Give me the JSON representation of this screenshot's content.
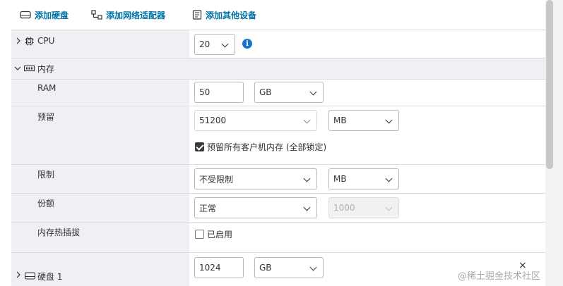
{
  "toolbar": {
    "add_disk": "添加硬盘",
    "add_network": "添加网络适配器",
    "add_other": "添加其他设备"
  },
  "cpu": {
    "label": "CPU",
    "value": "20"
  },
  "memory": {
    "label": "内存",
    "ram": {
      "label": "RAM",
      "value": "50",
      "unit": "GB"
    },
    "reservation": {
      "label": "预留",
      "value": "51200",
      "unit": "MB",
      "checkbox_label": "预留所有客户机内存 (全部锁定)",
      "checkbox_checked": true
    },
    "limit": {
      "label": "限制",
      "value": "不受限制",
      "unit": "MB"
    },
    "shares": {
      "label": "份额",
      "value": "正常",
      "number": "1000"
    },
    "hot_plug": {
      "label": "内存热插拔",
      "checkbox_label": "已启用",
      "checkbox_checked": false
    }
  },
  "disk1": {
    "label": "硬盘 1",
    "size": "1024",
    "unit": "GB"
  },
  "watermark": "@稀土掘金技术社区",
  "close_glyph": "×",
  "icons": {
    "info": "info-icon",
    "accent": "#0072a3",
    "info_color": "#1b74c7"
  }
}
